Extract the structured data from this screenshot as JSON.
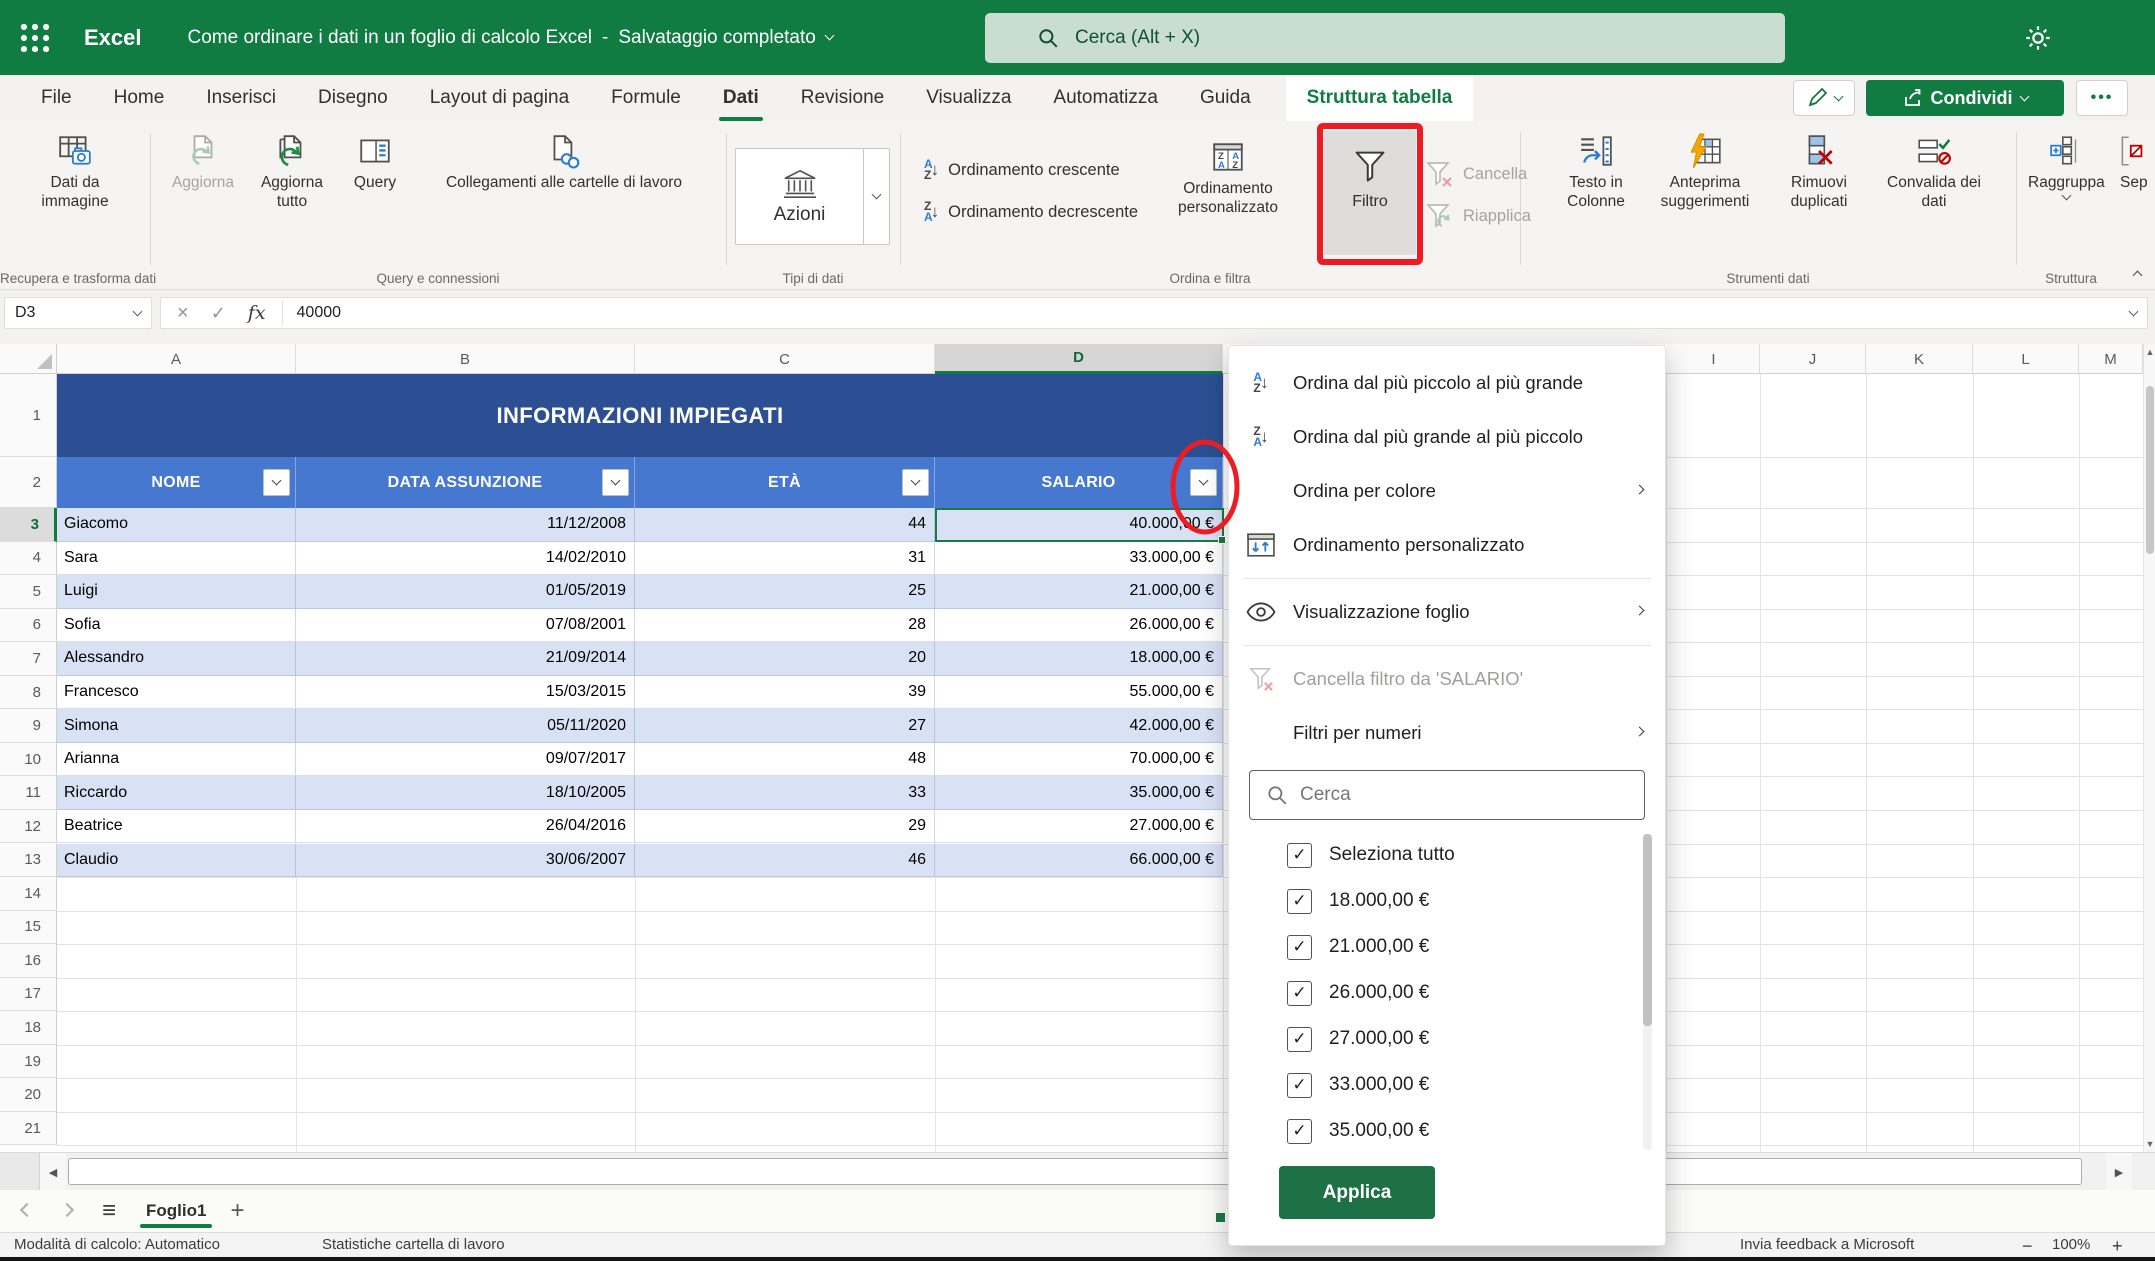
{
  "colors": {
    "brand_green": "#107C41",
    "annotation_red": "#ED1B24",
    "table_title_bg": "#2B4F92",
    "table_header_bg": "#4678D0",
    "band_row_bg": "#D9E2F5",
    "search_box_bg": "#C9DED1",
    "apply_button_bg": "#1E7145"
  },
  "titlebar": {
    "app_name": "Excel",
    "doc_title": "Come ordinare i dati in un foglio di calcolo Excel",
    "separator": "-",
    "save_status": "Salvataggio completato",
    "search_placeholder": "Cerca (Alt + X)"
  },
  "ribbon": {
    "tabs": [
      "File",
      "Home",
      "Inserisci",
      "Disegno",
      "Layout di pagina",
      "Formule",
      "Dati",
      "Revisione",
      "Visualizza",
      "Automatizza",
      "Guida"
    ],
    "active_tab": "Dati",
    "contextual_tab": "Struttura tabella",
    "share_label": "Condividi",
    "ellipsis_label": "•••",
    "groups": {
      "recupera": {
        "image_data": "Dati da immagine",
        "label": "Recupera e trasforma dati"
      },
      "query": {
        "refresh": "Aggiorna",
        "refresh_all": "Aggiorna tutto",
        "query": "Query",
        "links": "Collegamenti alle cartelle di lavoro",
        "label": "Query e connessioni"
      },
      "tipi": {
        "actions": "Azioni",
        "label": "Tipi di dati"
      },
      "ordina": {
        "asc": "Ordinamento crescente",
        "desc": "Ordinamento decrescente",
        "custom": "Ordinamento personalizzato",
        "filter": "Filtro",
        "clear": "Cancella",
        "reapply": "Riapplica",
        "label": "Ordina e filtra"
      },
      "strumenti": {
        "text_to_columns": "Testo in Colonne",
        "flash_fill": "Anteprima suggerimenti",
        "remove_duplicates": "Rimuovi duplicati",
        "data_validation": "Convalida dei dati",
        "label": "Strumenti dati"
      },
      "struttura": {
        "group": "Raggruppa",
        "ungroup_partial": "Sep",
        "label": "Struttura"
      }
    }
  },
  "formula_bar": {
    "cell_ref": "D3",
    "fx_label": "fx",
    "value": "40000"
  },
  "grid": {
    "columns_left": [
      "A",
      "B",
      "C",
      "D"
    ],
    "columns_right": [
      "I",
      "J",
      "K",
      "L",
      "M"
    ],
    "selected_column": "D",
    "selected_row": 3,
    "row_count": 21
  },
  "table": {
    "title": "INFORMAZIONI IMPIEGATI",
    "headers": [
      "NOME",
      "DATA ASSUNZIONE",
      "ETÀ",
      "SALARIO"
    ],
    "rows": [
      {
        "name": "Giacomo",
        "date": "11/12/2008",
        "age": "44",
        "salary": "40.000,00 €"
      },
      {
        "name": "Sara",
        "date": "14/02/2010",
        "age": "31",
        "salary": "33.000,00 €"
      },
      {
        "name": "Luigi",
        "date": "01/05/2019",
        "age": "25",
        "salary": "21.000,00 €"
      },
      {
        "name": "Sofia",
        "date": "07/08/2001",
        "age": "28",
        "salary": "26.000,00 €"
      },
      {
        "name": "Alessandro",
        "date": "21/09/2014",
        "age": "20",
        "salary": "18.000,00 €"
      },
      {
        "name": "Francesco",
        "date": "15/03/2015",
        "age": "39",
        "salary": "55.000,00 €"
      },
      {
        "name": "Simona",
        "date": "05/11/2020",
        "age": "27",
        "salary": "42.000,00 €"
      },
      {
        "name": "Arianna",
        "date": "09/07/2017",
        "age": "48",
        "salary": "70.000,00 €"
      },
      {
        "name": "Riccardo",
        "date": "18/10/2005",
        "age": "33",
        "salary": "35.000,00 €"
      },
      {
        "name": "Beatrice",
        "date": "26/04/2016",
        "age": "29",
        "salary": "27.000,00 €"
      },
      {
        "name": "Claudio",
        "date": "30/06/2007",
        "age": "46",
        "salary": "66.000,00 €"
      }
    ]
  },
  "filter_menu": {
    "items": [
      {
        "label": "Ordina dal più piccolo al più grande",
        "disabled": false,
        "has_submenu": false
      },
      {
        "label": "Ordina dal più grande al più piccolo",
        "disabled": false,
        "has_submenu": false
      },
      {
        "label": "Ordina per colore",
        "disabled": false,
        "has_submenu": true
      },
      {
        "label": "Ordinamento personalizzato",
        "disabled": false,
        "has_submenu": false
      },
      {
        "label": "Visualizzazione foglio",
        "disabled": false,
        "has_submenu": true
      },
      {
        "label": "Cancella filtro da 'SALARIO'",
        "disabled": true,
        "has_submenu": false
      },
      {
        "label": "Filtri per numeri",
        "disabled": false,
        "has_submenu": true
      }
    ],
    "search_placeholder": "Cerca",
    "checkbox_items": [
      "Seleziona tutto",
      "18.000,00 €",
      "21.000,00 €",
      "26.000,00 €",
      "27.000,00 €",
      "33.000,00 €",
      "35.000,00 €"
    ],
    "all_checked": true,
    "apply_label": "Applica"
  },
  "sheet_bar": {
    "sheet_name": "Foglio1"
  },
  "status_bar": {
    "calc_mode": "Modalità di calcolo: Automatico",
    "stats": "Statistiche cartella di lavoro",
    "feedback": "Invia feedback a Microsoft",
    "zoom_level": "100%"
  }
}
